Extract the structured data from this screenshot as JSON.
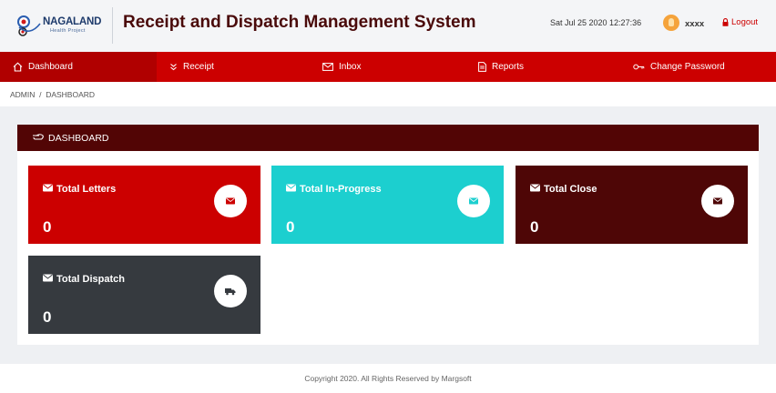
{
  "header": {
    "logo_name": "NAGALAND",
    "logo_sub": "Health Project",
    "title": "Receipt and Dispatch Management System",
    "datetime": "Sat Jul 25 2020 12:27:36",
    "username": "xxxx",
    "logout_label": "Logout"
  },
  "nav": {
    "items": [
      {
        "label": "Dashboard",
        "icon": "home-icon"
      },
      {
        "label": "Receipt",
        "icon": "chevrons-down-icon"
      },
      {
        "label": "Inbox",
        "icon": "envelope-icon"
      },
      {
        "label": "Reports",
        "icon": "document-icon"
      },
      {
        "label": "Change Password",
        "icon": "key-icon"
      }
    ]
  },
  "breadcrumb": "ADMIN  /  DASHBOARD",
  "panel": {
    "title": "DASHBOARD"
  },
  "cards": [
    {
      "title": "Total Letters",
      "value": "0",
      "color": "#cc0000",
      "icon": "envelope-icon"
    },
    {
      "title": "Total In-Progress",
      "value": "0",
      "color": "#1ccfcf",
      "icon": "envelope-icon"
    },
    {
      "title": "Total Close",
      "value": "0",
      "color": "#4e0606",
      "icon": "envelope-icon"
    },
    {
      "title": "Total Dispatch",
      "value": "0",
      "color": "#363a3f",
      "icon": "truck-icon"
    }
  ],
  "footer": {
    "copyright": "Copyright 2020. All Rights Reserved by Margsoft"
  },
  "colors": {
    "brand_red": "#cc0000",
    "dark_maroon": "#520505",
    "teal": "#1ccfcf",
    "dark_gray": "#363a3f"
  }
}
